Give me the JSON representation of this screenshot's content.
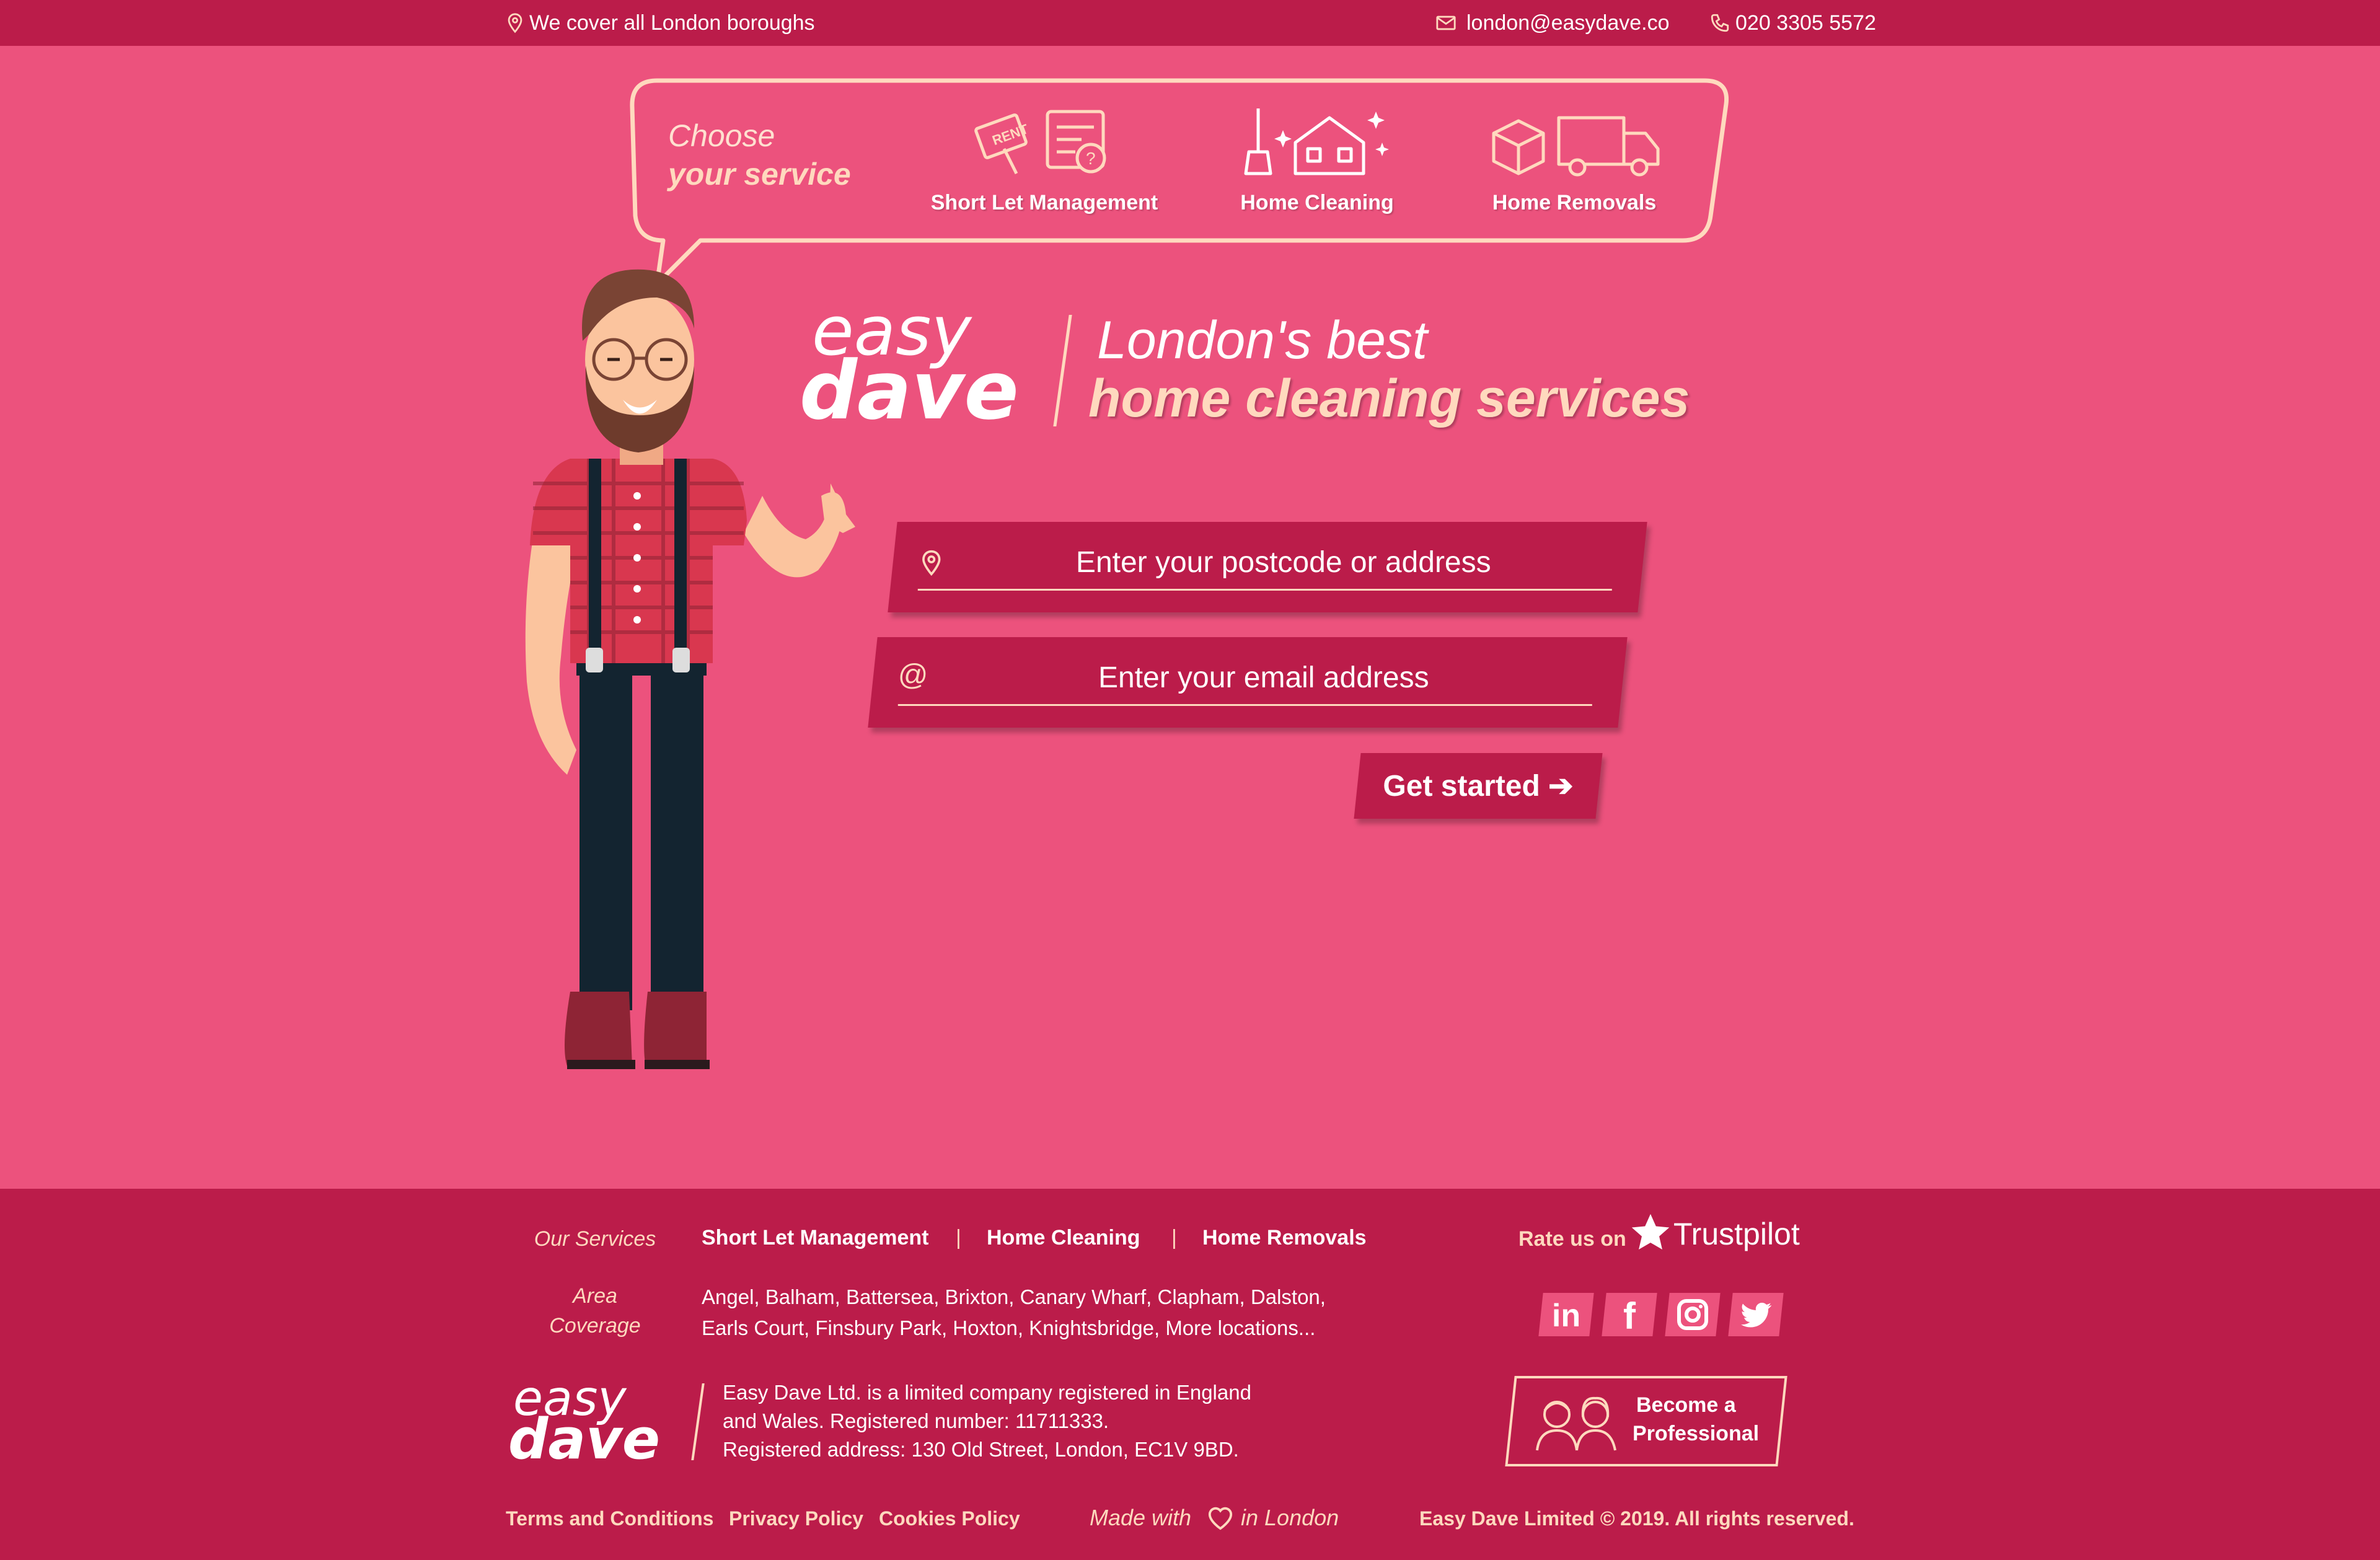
{
  "topbar": {
    "coverage": "We cover all London boroughs",
    "email": "london@easydave.co",
    "phone": "020 3305 5572",
    "icons": [
      "map-pin-icon",
      "envelope-icon",
      "phone-icon"
    ]
  },
  "bubble": {
    "choose": "Choose",
    "your_service": "your service",
    "services": [
      {
        "label": "Short Let Management",
        "icon": "rent-sign-icon"
      },
      {
        "label": "Home Cleaning",
        "icon": "sparkling-house-icon"
      },
      {
        "label": "Home Removals",
        "icon": "moving-truck-icon"
      }
    ]
  },
  "logo": {
    "easy": "easy",
    "dave": "dave"
  },
  "tagline": {
    "line1": "London's best",
    "line2": "home cleaning services"
  },
  "form": {
    "postcode_placeholder": "Enter your postcode or address",
    "email_placeholder": "Enter your email address",
    "submit_label": "Get started ➔"
  },
  "footer": {
    "services_heading": "Our Services",
    "services": [
      "Short Let Management",
      "Home Cleaning",
      "Home Removals"
    ],
    "area_heading_1": "Area",
    "area_heading_2": "Coverage",
    "area_line1": "Angel, Balham, Battersea, Brixton, Canary Wharf, Clapham, Dalston,",
    "area_line2": "Earls Court, Finsbury Park, Hoxton, Knightsbridge, More locations...",
    "company_line1": "Easy Dave Ltd. is a limited company registered in England",
    "company_line2": "and Wales. Registered number: 11711333.",
    "company_line3": "Registered address: 130 Old Street, London, EC1V 9BD.",
    "rate_us": "Rate us on",
    "trustpilot": "Trustpilot",
    "social": [
      "linkedin-icon",
      "facebook-icon",
      "instagram-icon",
      "twitter-icon"
    ],
    "pro_line1": "Become a",
    "pro_line2": "Professional",
    "legal_links": [
      "Terms and Conditions",
      "Privacy Policy",
      "Cookies Policy"
    ],
    "made_with_1": "Made with",
    "made_with_2": "in London",
    "copyright": "Easy Dave Limited © 2019. All rights reserved."
  },
  "colors": {
    "accent": "#BB1C4A",
    "background": "#EC527D",
    "highlight": "#FFD9BE"
  }
}
